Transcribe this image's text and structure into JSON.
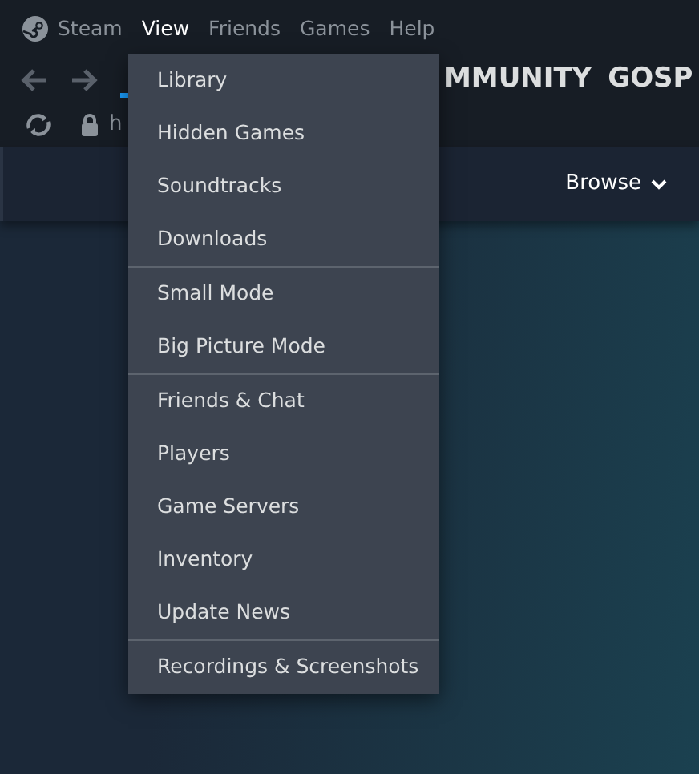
{
  "menubar": [
    {
      "label": "Steam",
      "selected": false
    },
    {
      "label": "View",
      "selected": true
    },
    {
      "label": "Friends",
      "selected": false
    },
    {
      "label": "Games",
      "selected": false
    },
    {
      "label": "Help",
      "selected": false
    }
  ],
  "nav": {
    "tabs": [
      "MMUNITY",
      "GOSP"
    ],
    "url": "h"
  },
  "store_bar": {
    "browse": "Browse"
  },
  "view_menu": [
    [
      {
        "label": "Library"
      },
      {
        "label": "Hidden Games"
      },
      {
        "label": "Soundtracks"
      },
      {
        "label": "Downloads"
      }
    ],
    [
      {
        "label": "Small Mode"
      },
      {
        "label": "Big Picture Mode"
      }
    ],
    [
      {
        "label": "Friends & Chat"
      },
      {
        "label": "Players"
      },
      {
        "label": "Game Servers"
      },
      {
        "label": "Inventory"
      },
      {
        "label": "Update News"
      }
    ],
    [
      {
        "label": "Recordings & Screenshots"
      }
    ]
  ]
}
